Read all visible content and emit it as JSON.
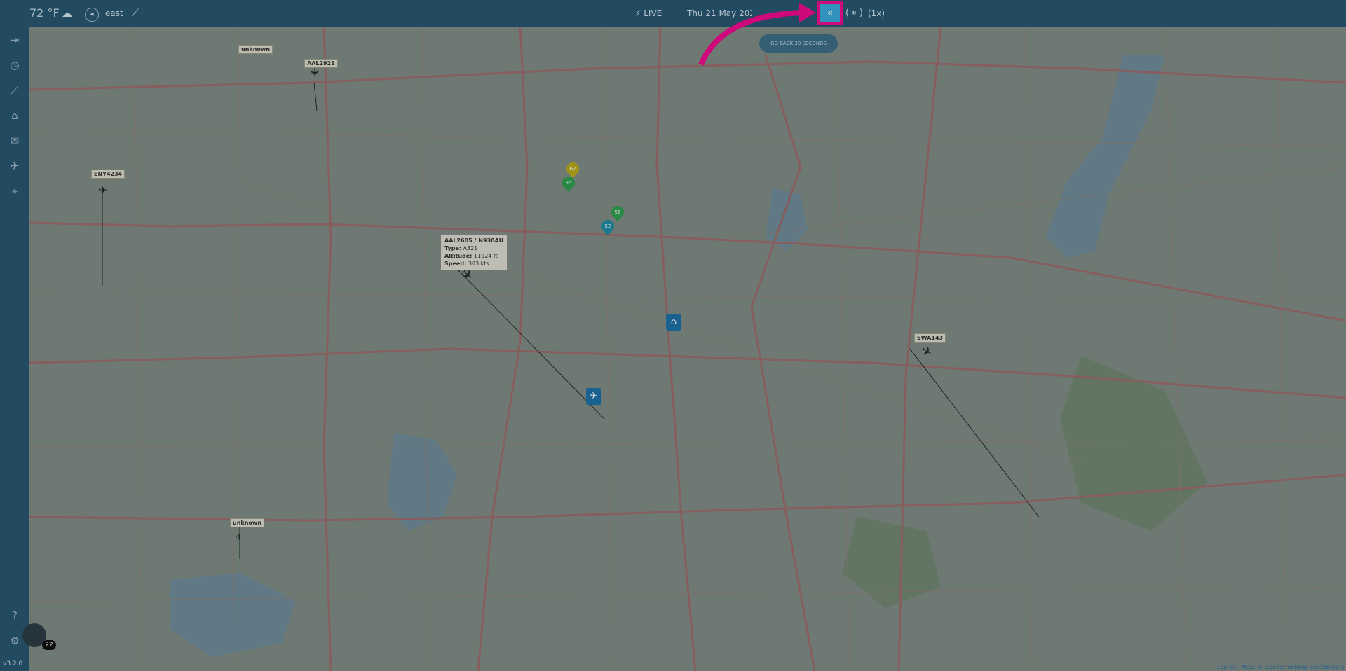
{
  "topbar": {
    "temperature": "72 °F",
    "weather_icon": "cloud-icon",
    "wind_label": "east",
    "live_label": "⚡ LIVE",
    "date_label": "Thu 21 May 2026",
    "rewind_label": "«",
    "pause_label": "( ⏸ )",
    "speed_label": "(1x)"
  },
  "tooltip": {
    "go_back": "GO BACK 30 SECONDS"
  },
  "sidebar": {
    "icons": [
      "exit-icon",
      "clock-icon",
      "chart-icon",
      "home-icon",
      "inbox-icon",
      "plane-icon",
      "location-pin-icon"
    ],
    "version": "v3.2.0",
    "badge_count": "22"
  },
  "flights": [
    {
      "label": "unknown"
    },
    {
      "label": "AAL2921"
    },
    {
      "label": "ENY4234"
    },
    {
      "label": "SWA143"
    },
    {
      "label": "unknown"
    }
  ],
  "popup": {
    "title": "AAL2605 / N930AU",
    "type_label": "Type:",
    "type_value": "A321",
    "altitude_label": "Altitude:",
    "altitude_value": "11924 ft",
    "speed_label": "Speed:",
    "speed_value": "303 kts"
  },
  "markers": [
    {
      "label": "62",
      "color": "#b8a818"
    },
    {
      "label": "55",
      "color": "#2e9c4e"
    },
    {
      "label": "56",
      "color": "#2e9c4e"
    },
    {
      "label": "52",
      "color": "#1e8aa0"
    }
  ],
  "attribution": "Leaflet | Map: © OpenStreetMap contributors",
  "colors": {
    "accent": "#3ba6d8",
    "highlight": "#ea0b8c",
    "bar": "#27566f"
  }
}
